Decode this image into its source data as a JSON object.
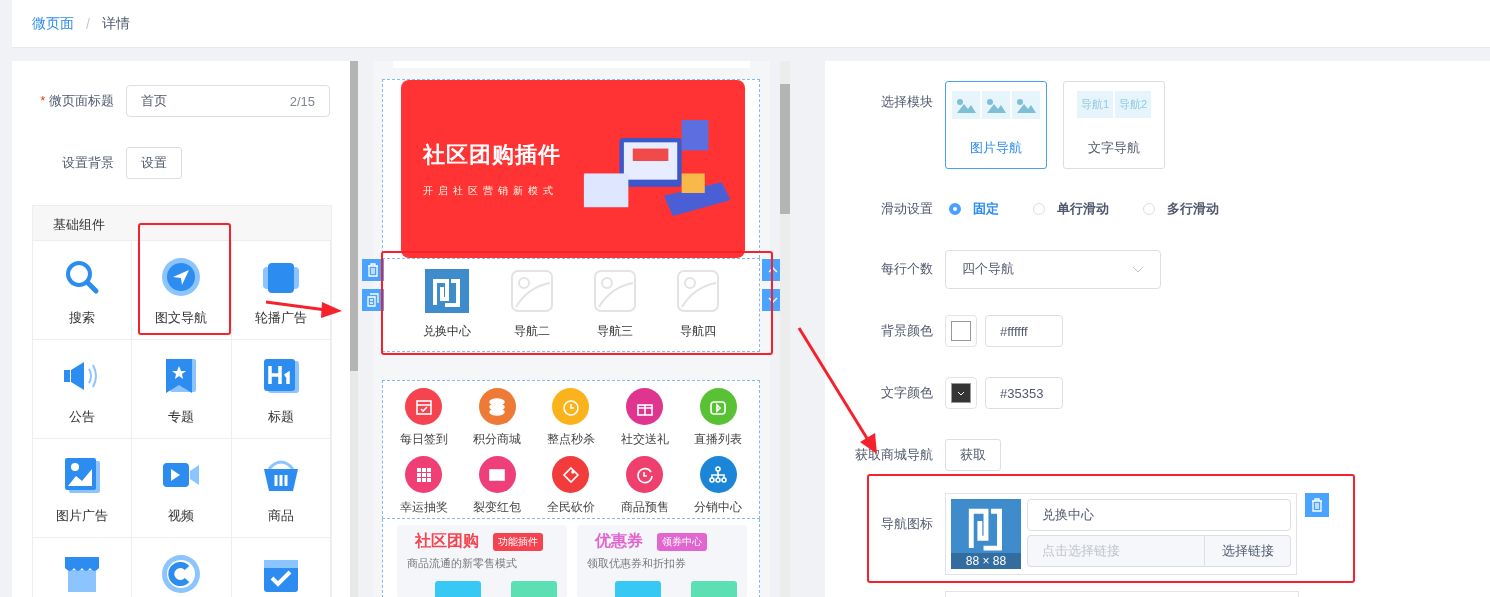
{
  "breadcrumb": {
    "items": [
      {
        "label": "微页面",
        "link": true
      },
      {
        "label": "详情",
        "link": false
      }
    ],
    "separator": "/"
  },
  "page_form": {
    "title_field": {
      "label": "微页面标题",
      "required": true,
      "required_mark": "*",
      "value": "首页",
      "counter": "2/15"
    },
    "background": {
      "label": "设置背景",
      "button": "设置"
    }
  },
  "component_panel": {
    "title": "基础组件",
    "items": [
      {
        "label": "搜索"
      },
      {
        "label": "图文导航"
      },
      {
        "label": "轮播广告"
      },
      {
        "label": "公告"
      },
      {
        "label": "专题"
      },
      {
        "label": "标题"
      },
      {
        "label": "图片广告"
      },
      {
        "label": "视频"
      },
      {
        "label": "商品"
      }
    ]
  },
  "preview": {
    "banner": {
      "title": "社区团购插件",
      "subtitle": "开启社区营销新模式"
    },
    "nav": {
      "items": [
        {
          "label": "兑换中心",
          "kind": "logo"
        },
        {
          "label": "导航二",
          "kind": "placeholder"
        },
        {
          "label": "导航三",
          "kind": "placeholder"
        },
        {
          "label": "导航四",
          "kind": "placeholder"
        }
      ]
    },
    "shortcuts": [
      {
        "label": "每日签到",
        "color": "#f5434f"
      },
      {
        "label": "积分商城",
        "color": "#ee7a35"
      },
      {
        "label": "整点秒杀",
        "color": "#fbb31c"
      },
      {
        "label": "社交送礼",
        "color": "#e0358f"
      },
      {
        "label": "直播列表",
        "color": "#59c234"
      },
      {
        "label": "幸运抽奖",
        "color": "#ef3f74"
      },
      {
        "label": "裂变红包",
        "color": "#ee3f7a"
      },
      {
        "label": "全民砍价",
        "color": "#f23c3c"
      },
      {
        "label": "商品预售",
        "color": "#ef3f6c"
      },
      {
        "label": "分销中心",
        "color": "#1b86d8"
      }
    ],
    "promos": [
      {
        "title": "社区团购",
        "badge": "功能插件",
        "subtitle": "商品流通的新零售模式",
        "color": "#f5434f"
      },
      {
        "title": "优惠券",
        "badge": "领券中心",
        "subtitle": "领取优惠券和折扣券",
        "color": "#e266d0"
      }
    ]
  },
  "settings": {
    "module": {
      "label": "选择模块",
      "options": [
        {
          "label": "图片导航",
          "kind": "image",
          "selected": true
        },
        {
          "label": "文字导航",
          "kind": "text",
          "selected": false,
          "preview": [
            "导航1",
            "导航2"
          ]
        }
      ]
    },
    "scroll": {
      "label": "滑动设置",
      "options": [
        {
          "label": "固定",
          "selected": true
        },
        {
          "label": "单行滑动",
          "selected": false
        },
        {
          "label": "多行滑动",
          "selected": false
        }
      ]
    },
    "per_row": {
      "label": "每行个数",
      "value": "四个导航"
    },
    "bg_color": {
      "label": "背景颜色",
      "color": "#ffffff",
      "value": "#ffffff"
    },
    "text_color": {
      "label": "文字颜色",
      "color": "#353535",
      "value": "#35353"
    },
    "fetch": {
      "label": "获取商城导航",
      "button": "获取"
    },
    "nav_icon": {
      "label": "导航图标",
      "image_caption": "88 × 88",
      "name_value": "兑换中心",
      "link_placeholder": "点击选择链接",
      "link_button": "选择链接"
    }
  }
}
